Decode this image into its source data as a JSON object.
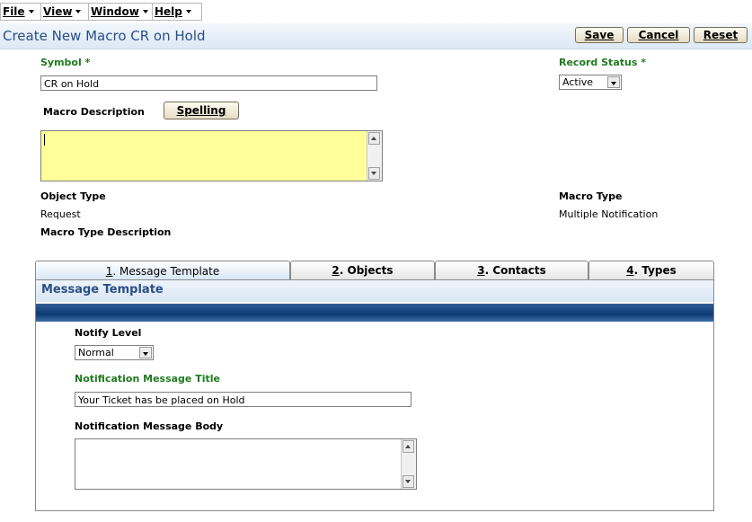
{
  "menu": [
    {
      "label": "File"
    },
    {
      "label": "View"
    },
    {
      "label": "Window"
    },
    {
      "label": "Help"
    }
  ],
  "page": {
    "title": "Create New Macro CR on Hold"
  },
  "actions": {
    "save": "Save",
    "cancel": "Cancel",
    "reset": "Reset"
  },
  "form": {
    "symbol_label": "Symbol *",
    "symbol_value": "CR on Hold",
    "record_status_label": "Record Status *",
    "record_status_value": "Active",
    "macro_description_label": "Macro Description",
    "spelling_button": "Spelling",
    "object_type_label": "Object Type",
    "object_type_value": "Request",
    "macro_type_label": "Macro Type",
    "macro_type_value": "Multiple Notification",
    "macro_type_description_label": "Macro Type Description"
  },
  "tabs": [
    {
      "num": "1",
      "label": ". Message Template",
      "active": true
    },
    {
      "num": "2",
      "label": ". Objects"
    },
    {
      "num": "3",
      "label": ". Contacts"
    },
    {
      "num": "4",
      "label": ". Types"
    }
  ],
  "message_template": {
    "header": "Message Template",
    "notify_level_label": "Notify Level",
    "notify_level_value": "Normal",
    "title_label": "Notification Message Title",
    "title_value": "Your Ticket has be placed on Hold",
    "body_label": "Notification Message Body",
    "body_value": ""
  },
  "colors": {
    "title_blue": "#2a4f87",
    "required_green": "#1f7a1f",
    "description_bg": "#ffff99",
    "header_bar": "#0d3a73"
  }
}
